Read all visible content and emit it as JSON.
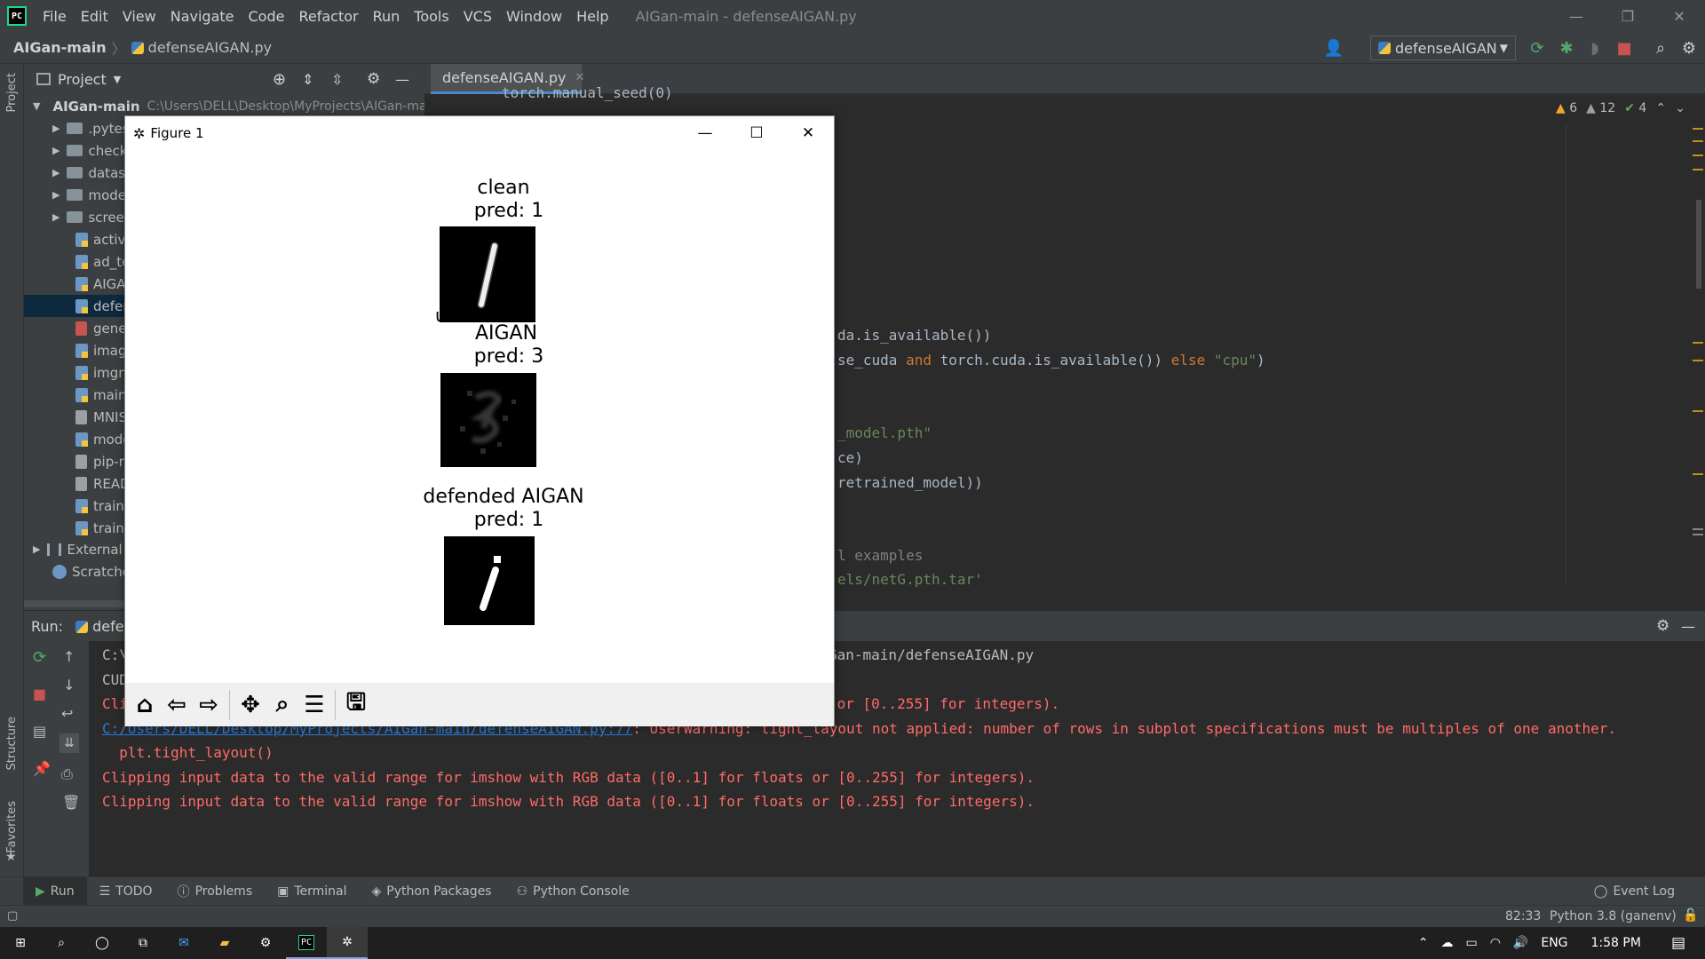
{
  "menubar": {
    "logo_text": "PC",
    "items": [
      "File",
      "Edit",
      "View",
      "Navigate",
      "Code",
      "Refactor",
      "Run",
      "Tools",
      "VCS",
      "Window",
      "Help"
    ],
    "window_title": "AIGan-main - defenseAIGAN.py",
    "minimize": "—",
    "restore": "❐",
    "close": "✕"
  },
  "navbar": {
    "project": "AIGan-main",
    "separator": "〉",
    "file": "defenseAIGAN.py",
    "run_config": "defenseAIGAN"
  },
  "leftstripe": {
    "project": "Project",
    "structure": "Structure",
    "favorites": "Favorites"
  },
  "project_panel": {
    "title": "Project",
    "root": {
      "name": "AIGan-main",
      "path": "C:\\Users\\DELL\\Desktop\\MyProjects\\AIGan-ma"
    },
    "items": [
      {
        "label": ".pytes",
        "kind": "folder"
      },
      {
        "label": "check",
        "kind": "folder"
      },
      {
        "label": "datas",
        "kind": "folder"
      },
      {
        "label": "mode",
        "kind": "folder"
      },
      {
        "label": "scree",
        "kind": "folder"
      },
      {
        "label": "activa",
        "kind": "py"
      },
      {
        "label": "ad_te",
        "kind": "py"
      },
      {
        "label": "AIGA",
        "kind": "py"
      },
      {
        "label": "defer",
        "kind": "py",
        "selected": true
      },
      {
        "label": "gener",
        "kind": "yml"
      },
      {
        "label": "imag",
        "kind": "py"
      },
      {
        "label": "imgn",
        "kind": "py"
      },
      {
        "label": "main.",
        "kind": "py"
      },
      {
        "label": "MNIS",
        "kind": "txt"
      },
      {
        "label": "mode",
        "kind": "py"
      },
      {
        "label": "pip-r",
        "kind": "txt"
      },
      {
        "label": "READ",
        "kind": "txt"
      },
      {
        "label": "train_",
        "kind": "py"
      },
      {
        "label": "train_",
        "kind": "py"
      }
    ],
    "external": "External",
    "scratches": "Scratches"
  },
  "editor": {
    "tab": "defenseAIGAN.py",
    "inspection": {
      "warn1": "6",
      "warn2": "12",
      "ok": "4"
    },
    "lines": {
      "l0": "torch.manual_seed(0)",
      "l1": "da.is_available())",
      "l2a": "se_cuda ",
      "l2b": "and",
      "l2c": " torch.cuda.is_available()) ",
      "l2d": "else",
      "l2e": " ",
      "l2f": "\"cpu\"",
      "l2g": ")",
      "l3": "_model.pth\"",
      "l4": "ce)",
      "l5": "retrained_model))",
      "l6": "l examples",
      "l7": "els/netG.pth.tar'"
    }
  },
  "run_panel": {
    "label": "Run:",
    "tab": "defe",
    "console": [
      {
        "text": "C:\\",
        "plain": true
      },
      {
        "text": "CUD",
        "plain": true
      },
      {
        "text": "Cli",
        "plain": false
      },
      {
        "text": "C:/Users/DELL/Desktop/MyProjects/AIGan-main/defenseAIGAN.py:77: UserWarning: tight_layout not applied: number of rows in subplot specifications must be multiples of one another.",
        "plain": false
      },
      {
        "text": "  plt.tight_layout()",
        "plain": false
      },
      {
        "text": "Clipping input data to the valid range for imshow with RGB data ([0..1] for floats or [0..255] for integers).",
        "plain": false
      },
      {
        "text": "Clipping input data to the valid range for imshow with RGB data ([0..1] for floats or [0..255] for integers).",
        "plain": false
      }
    ],
    "right_line0": "Gan-main/defenseAIGAN.py",
    "right_line2": " or [0..255] for integers)."
  },
  "tooltabs": [
    "Run",
    "TODO",
    "Problems",
    "Terminal",
    "Python Packages",
    "Python Console"
  ],
  "event_log": "Event Log",
  "status": {
    "position": "82:33",
    "interpreter": "Python 3.8 (ganenv)"
  },
  "taskbar": {
    "lang": "ENG",
    "time": "1:58 PM"
  },
  "figure": {
    "title": "Figure 1",
    "panels": [
      {
        "title": "clean",
        "pred": "pred: 1"
      },
      {
        "title": "AIGAN",
        "pred": "pred: 3"
      },
      {
        "title": "defended AIGAN",
        "pred": "pred: 1"
      }
    ],
    "toolbar": [
      "home",
      "back",
      "forward",
      "pan",
      "zoom",
      "configure",
      "save"
    ]
  }
}
